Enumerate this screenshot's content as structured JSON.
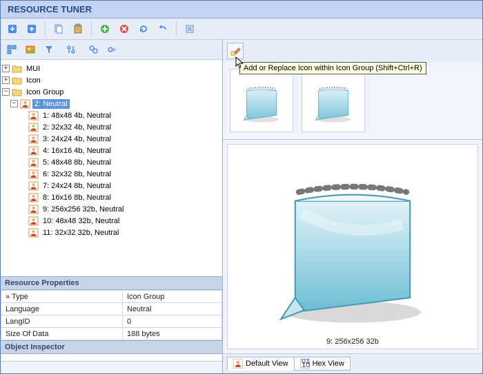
{
  "window": {
    "title": "RESOURCE TUNER"
  },
  "tree": {
    "root": [
      {
        "label": "MUI",
        "exp": "+",
        "indent": 0,
        "icon": "folder"
      },
      {
        "label": "Icon",
        "exp": "+",
        "indent": 0,
        "icon": "folder"
      },
      {
        "label": "Icon Group",
        "exp": "-",
        "indent": 0,
        "icon": "folder"
      },
      {
        "label": "2: Neutral",
        "exp": "-",
        "indent": 1,
        "icon": "person",
        "selected": true
      },
      {
        "label": "1: 48x48 4b, Neutral",
        "exp": "",
        "indent": 2,
        "icon": "person"
      },
      {
        "label": "2: 32x32 4b, Neutral",
        "exp": "",
        "indent": 2,
        "icon": "person"
      },
      {
        "label": "3: 24x24 4b, Neutral",
        "exp": "",
        "indent": 2,
        "icon": "person"
      },
      {
        "label": "4: 16x16 4b, Neutral",
        "exp": "",
        "indent": 2,
        "icon": "person"
      },
      {
        "label": "5: 48x48 8b, Neutral",
        "exp": "",
        "indent": 2,
        "icon": "person"
      },
      {
        "label": "6: 32x32 8b, Neutral",
        "exp": "",
        "indent": 2,
        "icon": "person"
      },
      {
        "label": "7: 24x24 8b, Neutral",
        "exp": "",
        "indent": 2,
        "icon": "person"
      },
      {
        "label": "8: 16x16 8b, Neutral",
        "exp": "",
        "indent": 2,
        "icon": "person"
      },
      {
        "label": "9: 256x256 32b, Neutral",
        "exp": "",
        "indent": 2,
        "icon": "person"
      },
      {
        "label": "10: 48x48 32b, Neutral",
        "exp": "",
        "indent": 2,
        "icon": "person"
      },
      {
        "label": "11: 32x32 32b, Neutral",
        "exp": "",
        "indent": 2,
        "icon": "person"
      }
    ]
  },
  "props": {
    "header": "Resource Properties",
    "rows": [
      {
        "k": "Type",
        "v": "Icon Group",
        "chevron": true
      },
      {
        "k": "Language",
        "v": "Neutral"
      },
      {
        "k": "LangID",
        "v": "0"
      },
      {
        "k": "Size Of Data",
        "v": "188 bytes"
      }
    ]
  },
  "inspector": {
    "header": "Object Inspector"
  },
  "tooltip": "Add or Replace Icon within Icon Group (Shift+Ctrl+R)",
  "preview": {
    "label": "9: 256x256 32b"
  },
  "tabs": {
    "default": "Default View",
    "hex": "Hex View"
  }
}
